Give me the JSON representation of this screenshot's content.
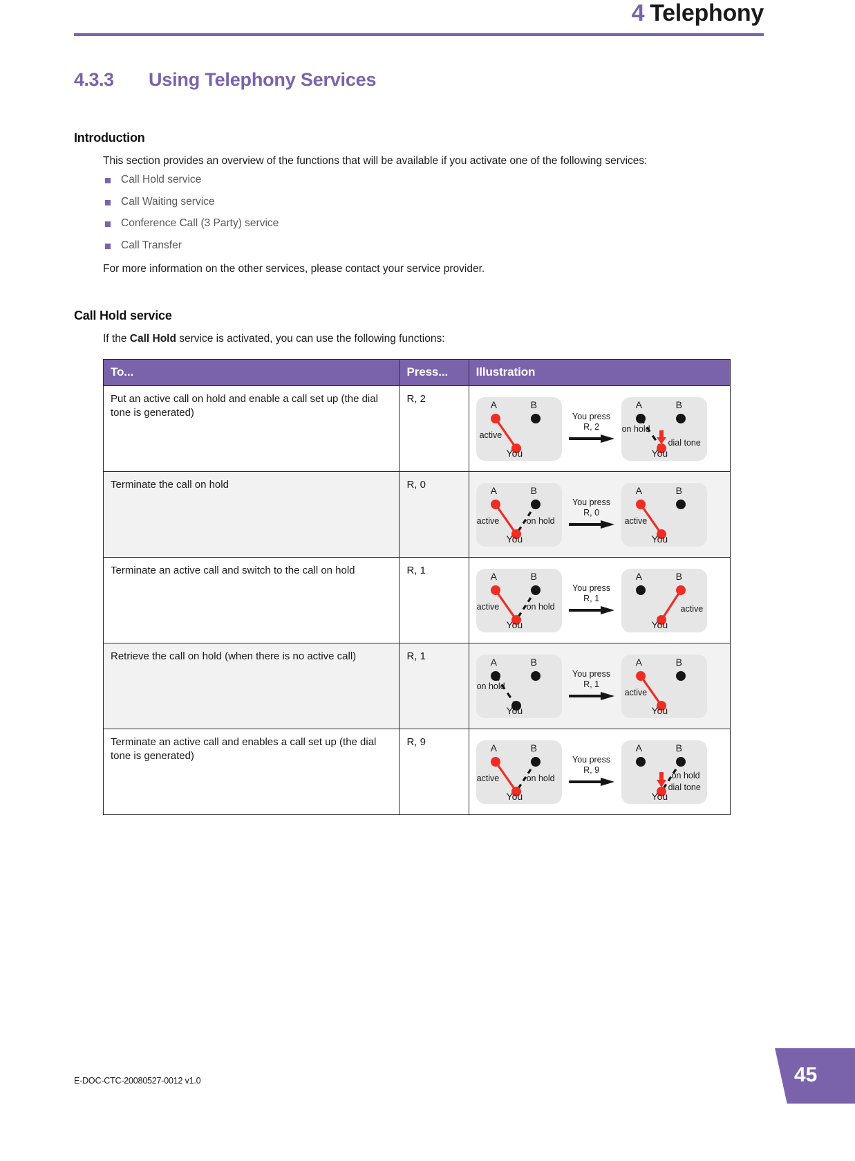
{
  "header": {
    "chapter_number": "4",
    "chapter_title": "Telephony"
  },
  "section": {
    "number": "4.3.3",
    "title": "Using Telephony Services"
  },
  "introduction": {
    "heading": "Introduction",
    "paragraph": "This section provides an overview of the functions that will be available if you activate one of the following services:",
    "bullets": [
      "Call Hold service",
      "Call Waiting service",
      "Conference Call (3 Party) service",
      "Call Transfer"
    ],
    "closing": "For more information on the other services, please contact your service provider."
  },
  "call_hold": {
    "heading": "Call Hold service",
    "intro_prefix": "If the ",
    "intro_bold": "Call Hold",
    "intro_suffix": " service is activated, you can use the following functions:",
    "table": {
      "columns": [
        "To...",
        "Press...",
        "Illustration"
      ],
      "rows": [
        {
          "to": "Put an active call on hold and enable a call set up (the dial tone is generated)",
          "press": "R, 2",
          "illustration": {
            "action_line1": "You press",
            "action_line2": "R, 2",
            "before": {
              "node_a": "A",
              "node_b": "B",
              "you": "You",
              "label_left": "active",
              "label_right": "",
              "label_extra": ""
            },
            "after": {
              "node_a": "A",
              "node_b": "B",
              "you": "You",
              "label_left": "on hold",
              "label_right": "dial tone",
              "label_extra": ""
            }
          }
        },
        {
          "to": "Terminate the call on hold",
          "press": "R, 0",
          "illustration": {
            "action_line1": "You press",
            "action_line2": "R, 0",
            "before": {
              "node_a": "A",
              "node_b": "B",
              "you": "You",
              "label_left": "active",
              "label_right": "on hold",
              "label_extra": ""
            },
            "after": {
              "node_a": "A",
              "node_b": "B",
              "you": "You",
              "label_left": "active",
              "label_right": "",
              "label_extra": ""
            }
          }
        },
        {
          "to": "Terminate an active call and switch to the call on hold",
          "press": "R, 1",
          "illustration": {
            "action_line1": "You press",
            "action_line2": "R, 1",
            "before": {
              "node_a": "A",
              "node_b": "B",
              "you": "You",
              "label_left": "active",
              "label_right": "on hold",
              "label_extra": ""
            },
            "after": {
              "node_a": "A",
              "node_b": "B",
              "you": "You",
              "label_left": "",
              "label_right": "active",
              "label_extra": ""
            }
          }
        },
        {
          "to": "Retrieve the call on hold (when there is no active call)",
          "press": "R, 1",
          "illustration": {
            "action_line1": "You press",
            "action_line2": "R, 1",
            "before": {
              "node_a": "A",
              "node_b": "B",
              "you": "You",
              "label_left": "on hold",
              "label_right": "",
              "label_extra": ""
            },
            "after": {
              "node_a": "A",
              "node_b": "B",
              "you": "You",
              "label_left": "active",
              "label_right": "",
              "label_extra": ""
            }
          }
        },
        {
          "to": "Terminate an active call and enables a call set up (the dial tone is generated)",
          "press": "R, 9",
          "illustration": {
            "action_line1": "You press",
            "action_line2": "R, 9",
            "before": {
              "node_a": "A",
              "node_b": "B",
              "you": "You",
              "label_left": "active",
              "label_right": "on hold",
              "label_extra": ""
            },
            "after": {
              "node_a": "A",
              "node_b": "B",
              "you": "You",
              "label_left": "",
              "label_right": "on hold",
              "label_extra": "dial tone"
            }
          }
        }
      ]
    }
  },
  "footer": {
    "doc_code": "E-DOC-CTC-20080527-0012 v1.0",
    "page_number": "45"
  },
  "colors": {
    "accent": "#7b63ac",
    "active_red": "#ee2d24",
    "node_black": "#151515",
    "panel_bg": "#e6e6e6"
  }
}
